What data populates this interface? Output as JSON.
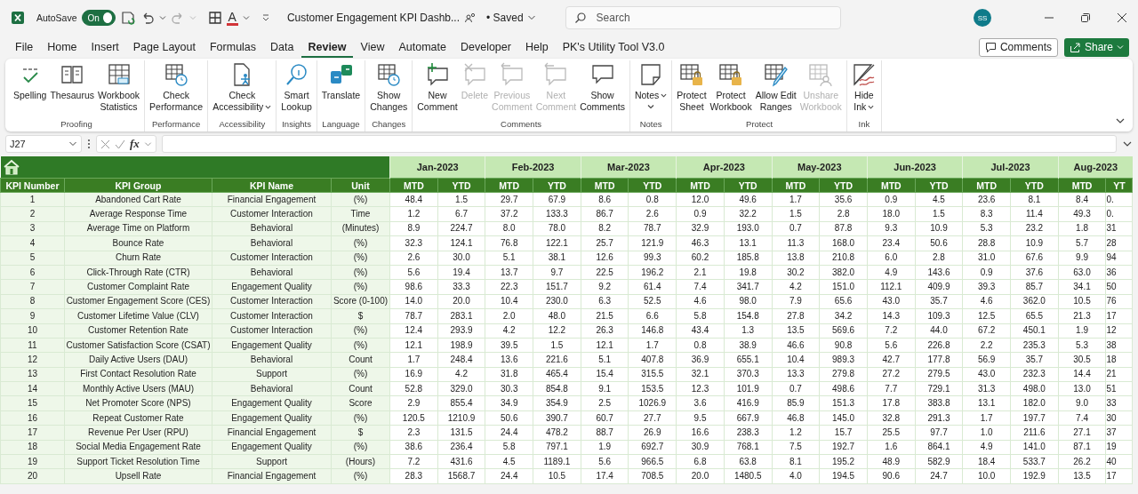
{
  "titlebar": {
    "autosave_label": "AutoSave",
    "autosave": {
      "label": "On",
      "on": true
    },
    "font_color_glyph": "A",
    "document_title": "Customer Engagement KPI Dashb...",
    "save_status": "• Saved",
    "search": {
      "placeholder": "Search"
    },
    "avatar": "SS"
  },
  "menu_tabs": [
    {
      "label": "File",
      "selected": false
    },
    {
      "label": "Home",
      "selected": false
    },
    {
      "label": "Insert",
      "selected": false
    },
    {
      "label": "Page Layout",
      "selected": false
    },
    {
      "label": "Formulas",
      "selected": false
    },
    {
      "label": "Data",
      "selected": false
    },
    {
      "label": "Review",
      "selected": true
    },
    {
      "label": "View",
      "selected": false
    },
    {
      "label": "Automate",
      "selected": false
    },
    {
      "label": "Developer",
      "selected": false
    },
    {
      "label": "Help",
      "selected": false
    },
    {
      "label": "PK's Utility Tool V3.0",
      "selected": false
    }
  ],
  "comments_button": "Comments",
  "share_button": "Share",
  "ribbon": [
    {
      "label": "Proofing",
      "buttons": [
        {
          "kind": "check",
          "label_lines": [
            "Spelling"
          ],
          "disabled": false,
          "dropdown": false
        },
        {
          "kind": "book",
          "label_lines": [
            "Thesaurus"
          ],
          "disabled": false,
          "dropdown": false
        },
        {
          "kind": "table",
          "label_lines": [
            "Workbook",
            "Statistics"
          ],
          "disabled": false,
          "dropdown": false
        }
      ]
    },
    {
      "label": "Performance",
      "buttons": [
        {
          "kind": "table-clock",
          "label_lines": [
            "Check",
            "Performance"
          ],
          "disabled": false,
          "dropdown": false
        }
      ]
    },
    {
      "label": "Accessibility",
      "buttons": [
        {
          "kind": "doc-person",
          "label_lines": [
            "Check",
            "Accessibility"
          ],
          "disabled": false,
          "dropdown": true
        }
      ]
    },
    {
      "label": "Insights",
      "buttons": [
        {
          "kind": "magnifier",
          "label_lines": [
            "Smart",
            "Lookup"
          ],
          "disabled": false,
          "dropdown": false
        }
      ]
    },
    {
      "label": "Language",
      "buttons": [
        {
          "kind": "translate",
          "label_lines": [
            "Translate"
          ],
          "disabled": false,
          "dropdown": false
        }
      ]
    },
    {
      "label": "Changes",
      "buttons": [
        {
          "kind": "table-clock",
          "label_lines": [
            "Show",
            "Changes"
          ],
          "disabled": false,
          "dropdown": false
        }
      ]
    },
    {
      "label": "Comments",
      "buttons": [
        {
          "kind": "comment-plus",
          "label_lines": [
            "New",
            "Comment"
          ],
          "disabled": false,
          "dropdown": false
        },
        {
          "kind": "comment-x",
          "label_lines": [
            "Delete"
          ],
          "disabled": true,
          "dropdown": false
        },
        {
          "kind": "comment-arrow",
          "label_lines": [
            "Previous",
            "Comment"
          ],
          "disabled": true,
          "dropdown": false
        },
        {
          "kind": "comment-arrow",
          "label_lines": [
            "Next",
            "Comment"
          ],
          "disabled": true,
          "dropdown": false
        },
        {
          "kind": "comment",
          "label_lines": [
            "Show",
            "Comments"
          ],
          "disabled": false,
          "dropdown": false
        }
      ]
    },
    {
      "label": "Notes",
      "buttons": [
        {
          "kind": "note",
          "label_lines": [
            "Notes"
          ],
          "disabled": false,
          "dropdown": true
        }
      ]
    },
    {
      "label": "Protect",
      "buttons": [
        {
          "kind": "table-lock",
          "label_lines": [
            "Protect",
            "Sheet"
          ],
          "disabled": false,
          "dropdown": false
        },
        {
          "kind": "table-lock",
          "label_lines": [
            "Protect",
            "Workbook"
          ],
          "disabled": false,
          "dropdown": false
        },
        {
          "kind": "table-pen",
          "label_lines": [
            "Allow Edit",
            "Ranges"
          ],
          "disabled": false,
          "dropdown": false
        },
        {
          "kind": "table-person",
          "label_lines": [
            "Unshare",
            "Workbook"
          ],
          "disabled": true,
          "dropdown": false
        }
      ]
    },
    {
      "label": "Ink",
      "buttons": [
        {
          "kind": "ink",
          "label_lines": [
            "Hide",
            "Ink"
          ],
          "disabled": false,
          "dropdown": true
        }
      ]
    }
  ],
  "formula_bar": {
    "name_box": "J27",
    "function_label": "fx"
  },
  "table": {
    "columns": [
      "KPI Number",
      "KPI Group",
      "KPI Name",
      "Unit"
    ],
    "months": [
      {
        "label": "Jan-2023",
        "columns": [
          "MTD",
          "YTD"
        ]
      },
      {
        "label": "Feb-2023",
        "columns": [
          "MTD",
          "YTD"
        ]
      },
      {
        "label": "Mar-2023",
        "columns": [
          "MTD",
          "YTD"
        ]
      },
      {
        "label": "Apr-2023",
        "columns": [
          "MTD",
          "YTD"
        ]
      },
      {
        "label": "May-2023",
        "columns": [
          "MTD",
          "YTD"
        ]
      },
      {
        "label": "Jun-2023",
        "columns": [
          "MTD",
          "YTD"
        ]
      },
      {
        "label": "Jul-2023",
        "columns": [
          "MTD",
          "YTD"
        ]
      },
      {
        "label": "Aug-2023",
        "columns": [
          "MTD",
          "YT"
        ]
      }
    ],
    "rows": [
      {
        "kpi_number": "1",
        "kpi_group": "Abandoned Cart Rate",
        "kpi_name": "Financial Engagement",
        "unit": "(%)",
        "values": [
          "48.4",
          "1.5",
          "29.7",
          "67.9",
          "8.6",
          "0.8",
          "12.0",
          "49.6",
          "1.7",
          "35.6",
          "0.9",
          "4.5",
          "23.6",
          "8.1",
          "8.4",
          "0."
        ]
      },
      {
        "kpi_number": "2",
        "kpi_group": "Average Response Time",
        "kpi_name": "Customer Interaction",
        "unit": "Time",
        "values": [
          "1.2",
          "6.7",
          "37.2",
          "133.3",
          "86.7",
          "2.6",
          "0.9",
          "32.2",
          "1.5",
          "2.8",
          "18.0",
          "1.5",
          "8.3",
          "11.4",
          "49.3",
          "0."
        ]
      },
      {
        "kpi_number": "3",
        "kpi_group": "Average Time on Platform",
        "kpi_name": "Behavioral",
        "unit": "(Minutes)",
        "values": [
          "8.9",
          "224.7",
          "8.0",
          "78.0",
          "8.2",
          "78.7",
          "32.9",
          "193.0",
          "0.7",
          "87.8",
          "9.3",
          "10.9",
          "5.3",
          "23.2",
          "1.8",
          "31"
        ]
      },
      {
        "kpi_number": "4",
        "kpi_group": "Bounce Rate",
        "kpi_name": "Behavioral",
        "unit": "(%)",
        "values": [
          "32.3",
          "124.1",
          "76.8",
          "122.1",
          "25.7",
          "121.9",
          "46.3",
          "13.1",
          "11.3",
          "168.0",
          "23.4",
          "50.6",
          "28.8",
          "10.9",
          "5.7",
          "28"
        ]
      },
      {
        "kpi_number": "5",
        "kpi_group": "Churn Rate",
        "kpi_name": "Customer Interaction",
        "unit": "(%)",
        "values": [
          "2.6",
          "30.0",
          "5.1",
          "38.1",
          "12.6",
          "99.3",
          "60.2",
          "185.8",
          "13.8",
          "210.8",
          "6.0",
          "2.8",
          "31.0",
          "67.6",
          "9.9",
          "94"
        ]
      },
      {
        "kpi_number": "6",
        "kpi_group": "Click-Through Rate (CTR)",
        "kpi_name": "Behavioral",
        "unit": "(%)",
        "values": [
          "5.6",
          "19.4",
          "13.7",
          "9.7",
          "22.5",
          "196.2",
          "2.1",
          "19.8",
          "30.2",
          "382.0",
          "4.9",
          "143.6",
          "0.9",
          "37.6",
          "63.0",
          "36"
        ]
      },
      {
        "kpi_number": "7",
        "kpi_group": "Customer Complaint Rate",
        "kpi_name": "Engagement Quality",
        "unit": "(%)",
        "values": [
          "98.6",
          "33.3",
          "22.3",
          "151.7",
          "9.2",
          "61.4",
          "7.4",
          "341.7",
          "4.2",
          "151.0",
          "112.1",
          "409.9",
          "39.3",
          "85.7",
          "34.1",
          "50"
        ]
      },
      {
        "kpi_number": "8",
        "kpi_group": "Customer Engagement Score (CES)",
        "kpi_name": "Customer Interaction",
        "unit": "Score (0-100)",
        "values": [
          "14.0",
          "20.0",
          "10.4",
          "230.0",
          "6.3",
          "52.5",
          "4.6",
          "98.0",
          "7.9",
          "65.6",
          "43.0",
          "35.7",
          "4.6",
          "362.0",
          "10.5",
          "76"
        ]
      },
      {
        "kpi_number": "9",
        "kpi_group": "Customer Lifetime Value (CLV)",
        "kpi_name": "Customer Interaction",
        "unit": "$",
        "values": [
          "78.7",
          "283.1",
          "2.0",
          "48.0",
          "21.5",
          "6.6",
          "5.8",
          "154.8",
          "27.8",
          "34.2",
          "14.3",
          "109.3",
          "12.5",
          "65.5",
          "21.3",
          "17"
        ]
      },
      {
        "kpi_number": "10",
        "kpi_group": "Customer Retention Rate",
        "kpi_name": "Customer Interaction",
        "unit": "(%)",
        "values": [
          "12.4",
          "293.9",
          "4.2",
          "12.2",
          "26.3",
          "146.8",
          "43.4",
          "1.3",
          "13.5",
          "569.6",
          "7.2",
          "44.0",
          "67.2",
          "450.1",
          "1.9",
          "12"
        ]
      },
      {
        "kpi_number": "11",
        "kpi_group": "Customer Satisfaction Score (CSAT)",
        "kpi_name": "Engagement Quality",
        "unit": "(%)",
        "values": [
          "12.1",
          "198.9",
          "39.5",
          "1.5",
          "12.1",
          "1.7",
          "0.8",
          "38.9",
          "46.6",
          "90.8",
          "5.6",
          "226.8",
          "2.2",
          "235.3",
          "5.3",
          "38"
        ]
      },
      {
        "kpi_number": "12",
        "kpi_group": "Daily Active Users (DAU)",
        "kpi_name": "Behavioral",
        "unit": "Count",
        "values": [
          "1.7",
          "248.4",
          "13.6",
          "221.6",
          "5.1",
          "407.8",
          "36.9",
          "655.1",
          "10.4",
          "989.3",
          "42.7",
          "177.8",
          "56.9",
          "35.7",
          "30.5",
          "18"
        ]
      },
      {
        "kpi_number": "13",
        "kpi_group": "First Contact Resolution Rate",
        "kpi_name": "Support",
        "unit": "(%)",
        "values": [
          "16.9",
          "4.2",
          "31.8",
          "465.4",
          "15.4",
          "315.5",
          "32.1",
          "370.3",
          "13.3",
          "279.8",
          "27.2",
          "279.5",
          "43.0",
          "232.3",
          "14.4",
          "21"
        ]
      },
      {
        "kpi_number": "14",
        "kpi_group": "Monthly Active Users (MAU)",
        "kpi_name": "Behavioral",
        "unit": "Count",
        "values": [
          "52.8",
          "329.0",
          "30.3",
          "854.8",
          "9.1",
          "153.5",
          "12.3",
          "101.9",
          "0.7",
          "498.6",
          "7.7",
          "729.1",
          "31.3",
          "498.0",
          "13.0",
          "51"
        ]
      },
      {
        "kpi_number": "15",
        "kpi_group": "Net Promoter Score (NPS)",
        "kpi_name": "Engagement Quality",
        "unit": "Score",
        "values": [
          "2.9",
          "855.4",
          "34.9",
          "354.9",
          "2.5",
          "1026.9",
          "3.6",
          "416.9",
          "85.9",
          "151.3",
          "17.8",
          "383.8",
          "13.1",
          "182.0",
          "9.0",
          "33"
        ]
      },
      {
        "kpi_number": "16",
        "kpi_group": "Repeat Customer Rate",
        "kpi_name": "Engagement Quality",
        "unit": "(%)",
        "values": [
          "120.5",
          "1210.9",
          "50.6",
          "390.7",
          "60.7",
          "27.7",
          "9.5",
          "667.9",
          "46.8",
          "145.0",
          "32.8",
          "291.3",
          "1.7",
          "197.7",
          "7.4",
          "30"
        ]
      },
      {
        "kpi_number": "17",
        "kpi_group": "Revenue Per User (RPU)",
        "kpi_name": "Financial Engagement",
        "unit": "$",
        "values": [
          "2.3",
          "131.5",
          "24.4",
          "478.2",
          "88.7",
          "26.9",
          "16.6",
          "238.3",
          "1.2",
          "15.7",
          "25.5",
          "97.7",
          "1.0",
          "211.6",
          "27.1",
          "37"
        ]
      },
      {
        "kpi_number": "18",
        "kpi_group": "Social Media Engagement Rate",
        "kpi_name": "Engagement Quality",
        "unit": "(%)",
        "values": [
          "38.6",
          "236.4",
          "5.8",
          "797.1",
          "1.9",
          "692.7",
          "30.9",
          "768.1",
          "7.5",
          "192.7",
          "1.6",
          "864.1",
          "4.9",
          "141.0",
          "87.1",
          "19"
        ]
      },
      {
        "kpi_number": "19",
        "kpi_group": "Support Ticket Resolution Time",
        "kpi_name": "Support",
        "unit": "(Hours)",
        "values": [
          "7.2",
          "431.6",
          "4.5",
          "1189.1",
          "5.6",
          "966.5",
          "6.8",
          "63.8",
          "8.1",
          "195.2",
          "48.9",
          "582.9",
          "18.4",
          "533.7",
          "26.2",
          "40"
        ]
      },
      {
        "kpi_number": "20",
        "kpi_group": "Upsell Rate",
        "kpi_name": "Financial Engagement",
        "unit": "(%)",
        "values": [
          "28.3",
          "1568.7",
          "24.4",
          "10.5",
          "17.4",
          "708.5",
          "20.0",
          "1480.5",
          "4.0",
          "194.5",
          "90.6",
          "24.7",
          "10.0",
          "192.9",
          "13.5",
          "17"
        ]
      }
    ]
  }
}
